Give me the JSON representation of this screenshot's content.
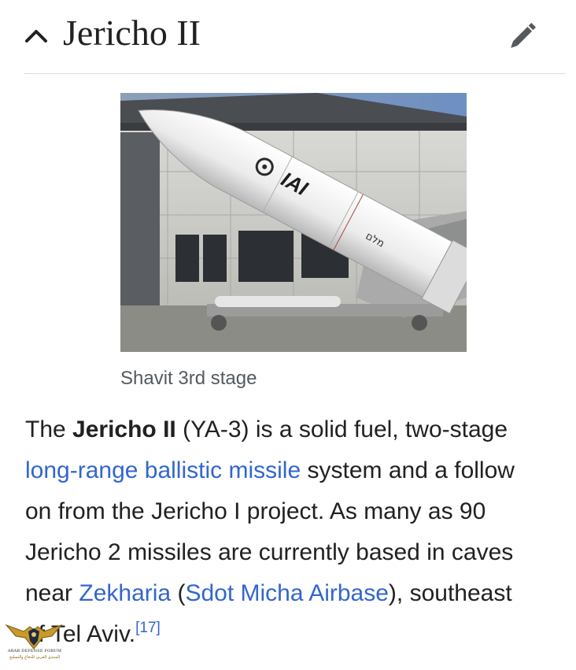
{
  "section": {
    "title": "Jericho II",
    "collapse_icon": "chevron-up-icon",
    "edit_icon": "pencil-icon"
  },
  "figure": {
    "caption": "Shavit 3rd stage",
    "rocket_labels": {
      "logo": "IAI",
      "hebrew": "מלם"
    }
  },
  "paragraph": {
    "t1": "The ",
    "b1": "Jericho II",
    "t2": " (YA-3) is a solid fuel, two-stage",
    "link1": "long-range ballistic missile",
    "t3": " system and a follow",
    "line3": "on from the Jericho I project. As many as 90",
    "line4": "Jericho 2 missiles are currently based in caves",
    "t4": "near ",
    "link2": "Zekharia",
    "t5": " (",
    "link3": "Sdot Micha Airbase",
    "t6": "), southeast",
    "t7": "of Tel Aviv.",
    "ref": "[17]"
  },
  "watermark": {
    "line1": "ARAB DEFENSE FORUM",
    "line2": "المنتدى العربي للدفاع والتسليح"
  },
  "colors": {
    "link": "#3366cc",
    "text": "#202122",
    "caption": "#54595d",
    "divider": "#d8dbdf",
    "icon": "#54595d"
  }
}
